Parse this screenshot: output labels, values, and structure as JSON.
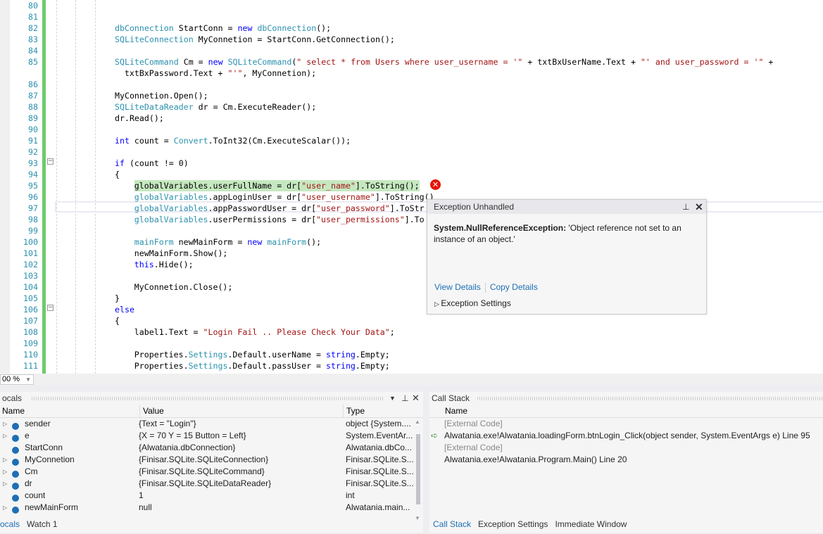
{
  "editor": {
    "lines": [
      {
        "n": "80",
        "indent": 0,
        "tokens": []
      },
      {
        "n": "81",
        "indent": 0,
        "tokens": []
      },
      {
        "n": "82",
        "indent": 0,
        "tokens": [
          [
            "type",
            "dbConnection"
          ],
          [
            "",
            "StartConn = "
          ],
          [
            "kw",
            "new "
          ],
          [
            "type",
            "dbConnection"
          ],
          [
            "",
            "();"
          ]
        ]
      },
      {
        "n": "83",
        "indent": 0,
        "tokens": [
          [
            "type",
            "SQLiteConnection"
          ],
          [
            "",
            "MyConnetion = StartConn.GetConnection();"
          ]
        ]
      },
      {
        "n": "84",
        "indent": 0,
        "tokens": []
      },
      {
        "n": "85",
        "indent": 0,
        "tokens": [
          [
            "type",
            "SQLiteCommand"
          ],
          [
            "",
            "Cm = "
          ],
          [
            "kw",
            "new "
          ],
          [
            "type",
            "SQLiteCommand"
          ],
          [
            "",
            "("
          ],
          [
            "str",
            "\" select * from Users where user_username = '\""
          ],
          [
            "",
            " + txtBxUserName.Text + "
          ],
          [
            "str",
            "\"' and user_password = '\""
          ],
          [
            "",
            " +"
          ]
        ]
      },
      {
        "n": "",
        "indent": 2,
        "tokens": [
          [
            "",
            "txtBxPassword.Text + "
          ],
          [
            "str",
            "\"'\""
          ],
          [
            "",
            ", MyConnetion);"
          ]
        ]
      },
      {
        "n": "86",
        "indent": 0,
        "tokens": []
      },
      {
        "n": "87",
        "indent": 0,
        "tokens": [
          [
            "",
            "MyConnetion.Open();"
          ]
        ]
      },
      {
        "n": "88",
        "indent": 0,
        "tokens": [
          [
            "type",
            "SQLiteDataReader"
          ],
          [
            "",
            "dr = Cm.ExecuteReader();"
          ]
        ]
      },
      {
        "n": "89",
        "indent": 0,
        "tokens": [
          [
            "",
            "dr.Read();"
          ]
        ]
      },
      {
        "n": "90",
        "indent": 0,
        "tokens": []
      },
      {
        "n": "91",
        "indent": 0,
        "tokens": [
          [
            "kw",
            "int "
          ],
          [
            "",
            "count = "
          ],
          [
            "type",
            "Convert"
          ],
          [
            "",
            ".ToInt32(Cm.ExecuteScalar());"
          ]
        ]
      },
      {
        "n": "92",
        "indent": 0,
        "tokens": []
      },
      {
        "n": "93",
        "indent": 0,
        "tokens": [
          [
            "kw",
            "if "
          ],
          [
            "",
            "(count != 0)"
          ]
        ]
      },
      {
        "n": "94",
        "indent": 0,
        "tokens": [
          [
            "",
            "{"
          ]
        ]
      },
      {
        "n": "95",
        "indent": 4,
        "highlight": true,
        "tokens": [
          [
            "",
            "globalVariables.userFullName = dr["
          ],
          [
            "str",
            "\"user_name\""
          ],
          [
            "",
            "].ToString();"
          ]
        ]
      },
      {
        "n": "96",
        "indent": 4,
        "tokens": [
          [
            "type",
            "globalVariables"
          ],
          [
            "",
            ".appLoginUser = dr["
          ],
          [
            "str",
            "\"user_username\""
          ],
          [
            "",
            "].ToString()"
          ]
        ]
      },
      {
        "n": "97",
        "indent": 4,
        "tokens": [
          [
            "type",
            "globalVariables"
          ],
          [
            "",
            ".appPasswordUser = dr["
          ],
          [
            "str",
            "\"user_password\""
          ],
          [
            "",
            "].ToStr"
          ]
        ]
      },
      {
        "n": "98",
        "indent": 4,
        "tokens": [
          [
            "type",
            "globalVariables"
          ],
          [
            "",
            ".userPermissions = dr["
          ],
          [
            "str",
            "\"user_permissions\""
          ],
          [
            "",
            "].To"
          ]
        ]
      },
      {
        "n": "99",
        "indent": 0,
        "tokens": []
      },
      {
        "n": "100",
        "indent": 4,
        "tokens": [
          [
            "type",
            "mainForm"
          ],
          [
            "",
            "newMainForm = "
          ],
          [
            "kw",
            "new "
          ],
          [
            "type",
            "mainForm"
          ],
          [
            "",
            "();"
          ]
        ]
      },
      {
        "n": "101",
        "indent": 4,
        "tokens": [
          [
            "",
            "newMainForm.Show();"
          ]
        ]
      },
      {
        "n": "102",
        "indent": 4,
        "tokens": [
          [
            "kw",
            "this"
          ],
          [
            "",
            ".Hide();"
          ]
        ]
      },
      {
        "n": "103",
        "indent": 0,
        "tokens": []
      },
      {
        "n": "104",
        "indent": 4,
        "tokens": [
          [
            "",
            "MyConnetion.Close();"
          ]
        ]
      },
      {
        "n": "105",
        "indent": 0,
        "tokens": [
          [
            "",
            "}"
          ]
        ]
      },
      {
        "n": "106",
        "indent": 0,
        "tokens": [
          [
            "kw",
            "else"
          ]
        ]
      },
      {
        "n": "107",
        "indent": 0,
        "tokens": [
          [
            "",
            "{"
          ]
        ]
      },
      {
        "n": "108",
        "indent": 4,
        "tokens": [
          [
            "",
            "label1.Text = "
          ],
          [
            "str",
            "\"Login Fail .. Please Check Your Data\""
          ],
          [
            "",
            ";"
          ]
        ]
      },
      {
        "n": "109",
        "indent": 0,
        "tokens": []
      },
      {
        "n": "110",
        "indent": 4,
        "tokens": [
          [
            "",
            "Properties."
          ],
          [
            "type",
            "Settings"
          ],
          [
            "",
            ".Default.userName = "
          ],
          [
            "kw",
            "string"
          ],
          [
            "",
            ".Empty;"
          ]
        ]
      },
      {
        "n": "111",
        "indent": 4,
        "tokens": [
          [
            "",
            "Properties."
          ],
          [
            "type",
            "Settings"
          ],
          [
            "",
            ".Default.passUser = "
          ],
          [
            "kw",
            "string"
          ],
          [
            "",
            ".Empty;"
          ]
        ]
      }
    ],
    "zoom": "00 %"
  },
  "exception": {
    "title": "Exception Unhandled",
    "type": "System.NullReferenceException:",
    "message": " 'Object reference not set to an instance of an object.'",
    "view_details": "View Details",
    "copy_details": "Copy Details",
    "settings": "Exception Settings"
  },
  "locals": {
    "title": "ocals",
    "columns": [
      "Name",
      "Value",
      "Type"
    ],
    "rows": [
      {
        "expand": true,
        "name": "sender",
        "value": "{Text = \"Login\"}",
        "type": "object {System...."
      },
      {
        "expand": true,
        "name": "e",
        "value": "{X = 70 Y = 15 Button = Left}",
        "type": "System.EventAr..."
      },
      {
        "expand": false,
        "name": "StartConn",
        "value": "{Alwatania.dbConnection}",
        "type": "Alwatania.dbCo..."
      },
      {
        "expand": true,
        "name": "MyConnetion",
        "value": "{Finisar.SQLite.SQLiteConnection}",
        "type": "Finisar.SQLite.S..."
      },
      {
        "expand": true,
        "name": "Cm",
        "value": "{Finisar.SQLite.SQLiteCommand}",
        "type": "Finisar.SQLite.S..."
      },
      {
        "expand": true,
        "name": "dr",
        "value": "{Finisar.SQLite.SQLiteDataReader}",
        "type": "Finisar.SQLite.S..."
      },
      {
        "expand": false,
        "name": "count",
        "value": "1",
        "type": "int"
      },
      {
        "expand": true,
        "name": "newMainForm",
        "value": "null",
        "type": "Alwatania.main..."
      }
    ],
    "tabs": [
      "ocals",
      "Watch 1"
    ]
  },
  "callstack": {
    "title": "Call Stack",
    "column": "Name",
    "rows": [
      {
        "text": "[External Code]",
        "external": true
      },
      {
        "text": "Alwatania.exe!Alwatania.loadingForm.btnLogin_Click(object sender, System.EventArgs e) Line 95",
        "current": true
      },
      {
        "text": "[External Code]",
        "external": true
      },
      {
        "text": "Alwatania.exe!Alwatania.Program.Main() Line 20"
      }
    ],
    "tabs": [
      "Call Stack",
      "Exception Settings",
      "Immediate Window"
    ]
  },
  "colors": {
    "accent": "#1e6fb4",
    "error": "#e51400",
    "changed_bar": "#6ccb6c",
    "highlight": "#c6e8c0"
  }
}
